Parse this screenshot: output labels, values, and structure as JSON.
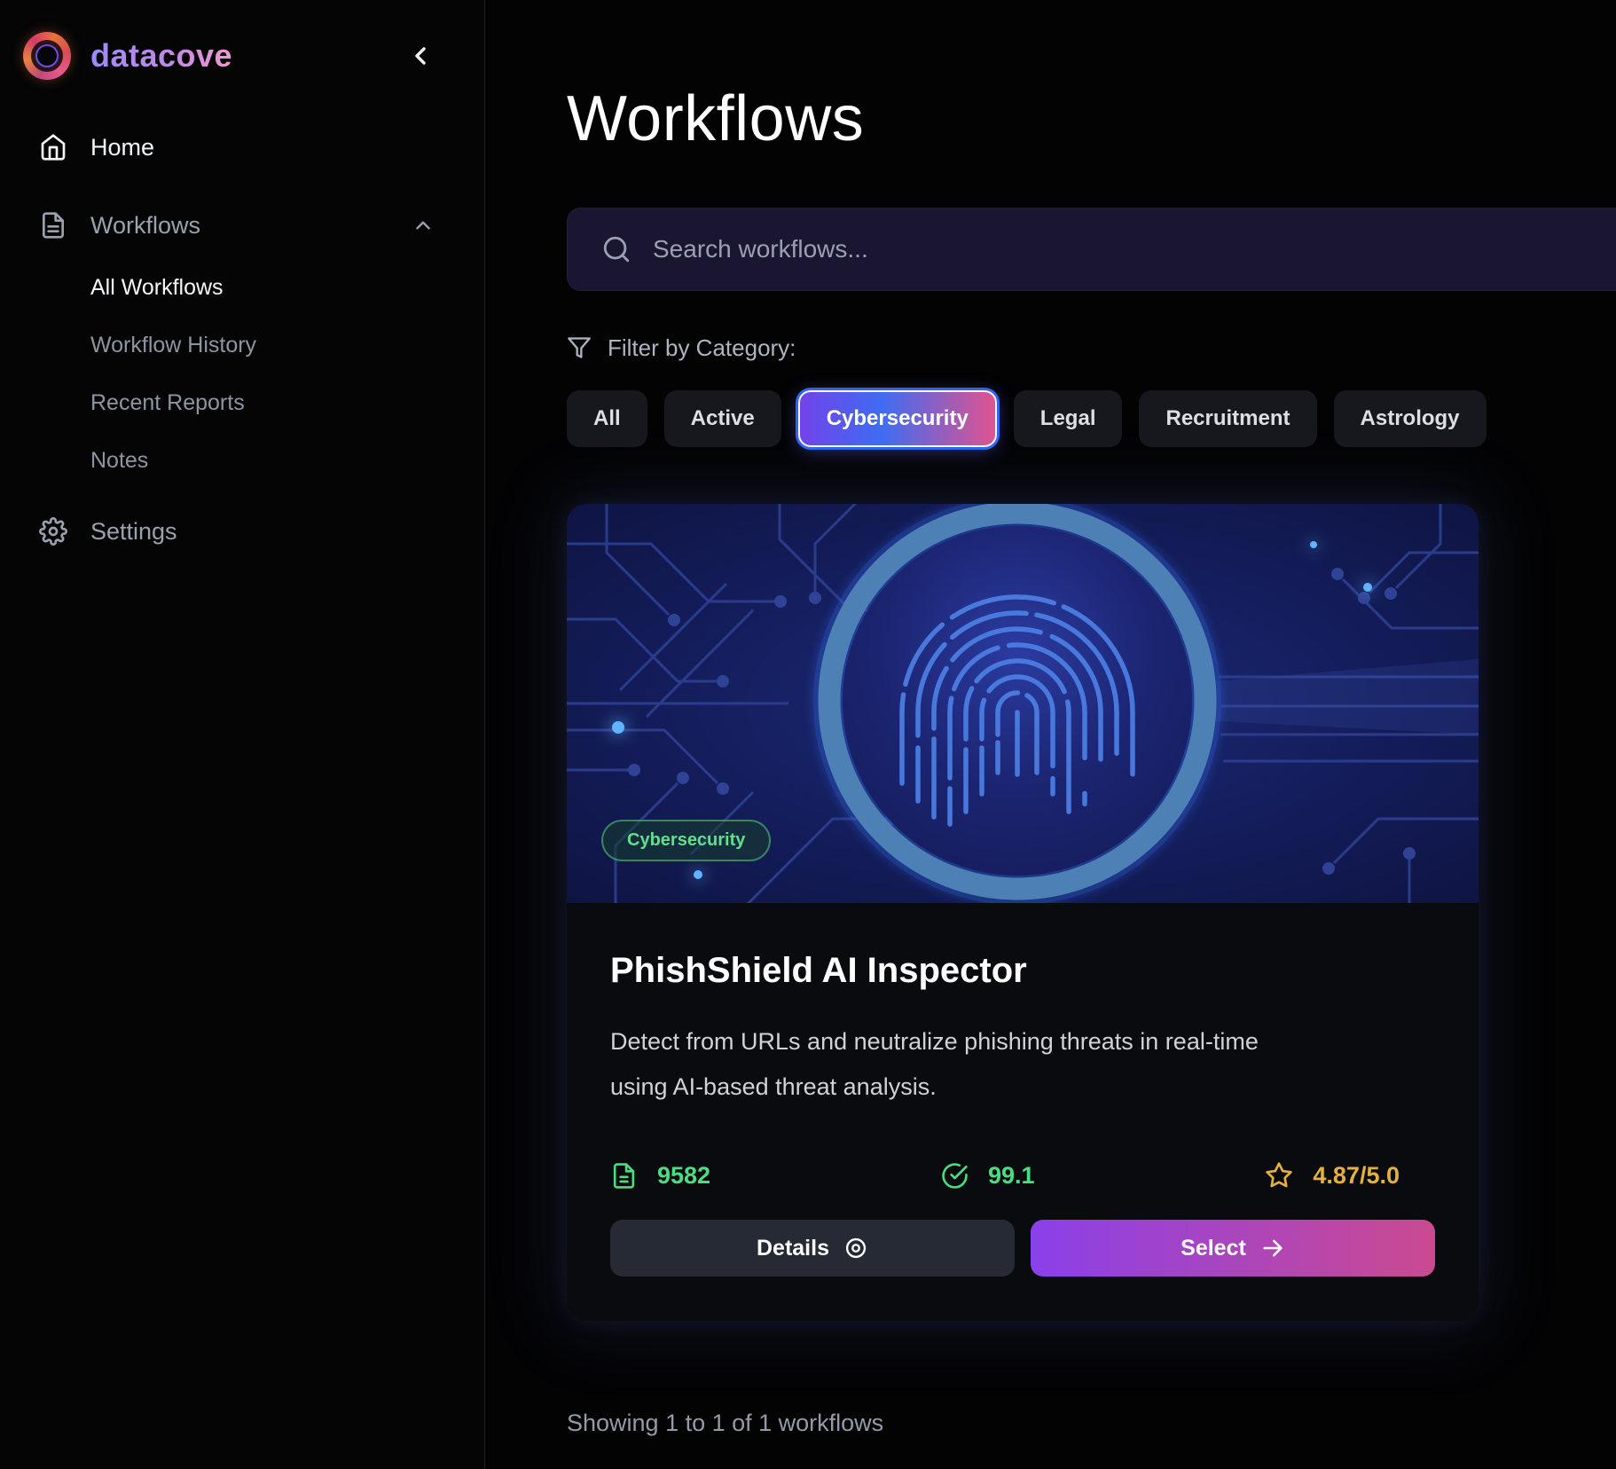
{
  "sidebar": {
    "brand": "datacove",
    "items": [
      {
        "label": "Home",
        "icon": "home-icon"
      },
      {
        "label": "Workflows",
        "icon": "file-text-icon",
        "expanded": true
      }
    ],
    "sub_items": [
      {
        "label": "All Workflows",
        "active": true
      },
      {
        "label": "Workflow History",
        "active": false
      },
      {
        "label": "Recent Reports",
        "active": false
      },
      {
        "label": "Notes",
        "active": false
      }
    ],
    "settings_label": "Settings"
  },
  "main": {
    "title": "Workflows",
    "search": {
      "placeholder": "Search workflows..."
    },
    "filter": {
      "label": "Filter by Category:",
      "categories": [
        "All",
        "Active",
        "Cybersecurity",
        "Legal",
        "Recruitment",
        "Astrology"
      ],
      "selected": "Cybersecurity"
    },
    "card": {
      "badge": "Cybersecurity",
      "title": "PhishShield AI Inspector",
      "description": "Detect from URLs and neutralize phishing threats in real-time using AI-based threat analysis.",
      "stats": {
        "documents": "9582",
        "score": "99.1",
        "rating": "4.87/5.0"
      },
      "details_label": "Details",
      "select_label": "Select"
    },
    "footer": "Showing 1 to 1 of 1 workflows"
  },
  "icons": {
    "logo": "mandala-rosette",
    "collapse": "chevron-left",
    "search": "magnifier",
    "filter": "funnel",
    "documents_stat": "file-text",
    "score_stat": "check-circle",
    "rating_stat": "star-outline",
    "details": "target-eye",
    "select": "arrow-right"
  },
  "colors": {
    "brand_gradient": [
      "#9d8bf7",
      "#f09ace"
    ],
    "selected_chip_gradient": [
      "#7243e9",
      "#3f6cf2",
      "#e05390"
    ],
    "select_button_gradient": [
      "#8a40ea",
      "#cb4a90"
    ],
    "stat_green": "#4ade80",
    "stat_gold": "#e5b13d",
    "badge_green": "#62de8d",
    "image_navy": "#131c58"
  }
}
